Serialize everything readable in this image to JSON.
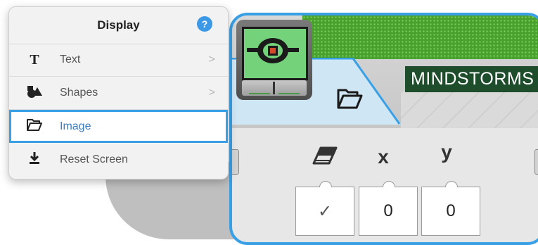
{
  "menu": {
    "title": "Display",
    "help_label": "?",
    "items": [
      {
        "label": "Text",
        "icon": "text-T-icon",
        "has_submenu": true,
        "chevron": ">"
      },
      {
        "label": "Shapes",
        "icon": "shapes-icon",
        "has_submenu": true,
        "chevron": ">"
      },
      {
        "label": "Image",
        "icon": "folder-open-icon",
        "has_submenu": false,
        "selected": true
      },
      {
        "label": "Reset Screen",
        "icon": "download-reset-icon",
        "has_submenu": false
      }
    ]
  },
  "block": {
    "brand_label": "MINDSTORMS",
    "accent_color": "#3aa0e6",
    "params": [
      {
        "icon": "eraser-icon",
        "label": "",
        "value": "✓"
      },
      {
        "icon": "x-coordinate-label",
        "label": "x",
        "value": "0"
      },
      {
        "icon": "y-coordinate-label",
        "label": "y",
        "value": "0"
      }
    ]
  }
}
